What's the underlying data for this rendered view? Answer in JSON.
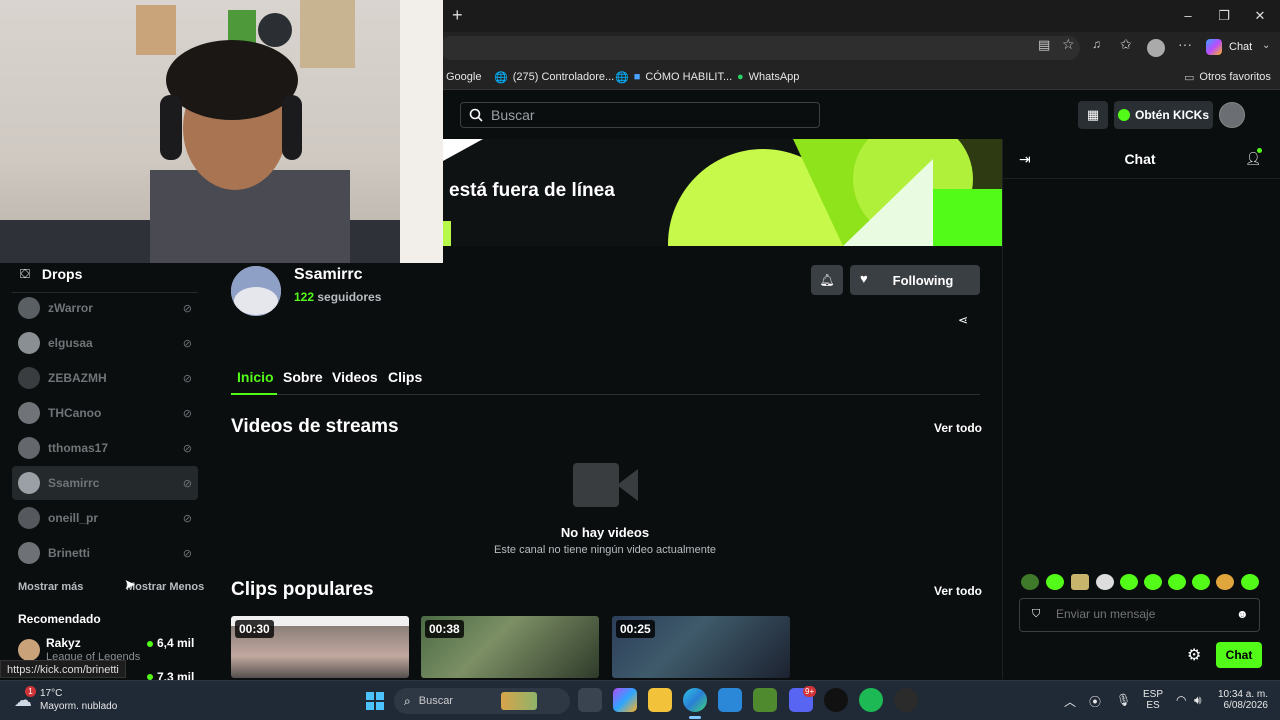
{
  "browser": {
    "chat_button": "Chat",
    "favorites": [
      {
        "label": "Google"
      },
      {
        "label": "(275) Controladore..."
      },
      {
        "label": "CÓMO HABILIT..."
      },
      {
        "label": "WhatsApp"
      }
    ],
    "other_favorites": "Otros favoritos",
    "status_url": "https://kick.com/brinetti"
  },
  "header": {
    "search_placeholder": "Buscar",
    "get_kicks": "Obtén KICKs"
  },
  "banner": {
    "offline_text": "está fuera de línea"
  },
  "sidebar": {
    "drops_label": "Drops",
    "following": [
      {
        "name": "zWarror"
      },
      {
        "name": "elgusaa"
      },
      {
        "name": "ZEBAZMH"
      },
      {
        "name": "THCanoo"
      },
      {
        "name": "tthomas17"
      },
      {
        "name": "Ssamirrc"
      },
      {
        "name": "oneill_pr"
      },
      {
        "name": "Brinetti"
      }
    ],
    "show_more": "Mostrar más",
    "show_less": "Mostrar Menos",
    "recommended_title": "Recomendado",
    "recommended": [
      {
        "name": "Rakyz",
        "category": "League of Legends",
        "viewers": "6,4 mil"
      },
      {
        "viewers": "7,3 mil"
      }
    ]
  },
  "channel": {
    "name": "Ssamirrc",
    "followers_count": "122",
    "followers_label": "seguidores",
    "following_button": "Following",
    "tabs": [
      "Inicio",
      "Sobre",
      "Videos",
      "Clips"
    ],
    "active_tab": "Inicio",
    "videos_title": "Videos de streams",
    "see_all": "Ver todo",
    "no_videos_title": "No hay videos",
    "no_videos_desc": "Este canal no tiene ningún video actualmente",
    "clips_title": "Clips populares",
    "clips": [
      {
        "duration": "00:30"
      },
      {
        "duration": "00:38"
      },
      {
        "duration": "00:25"
      }
    ]
  },
  "chat": {
    "title": "Chat",
    "input_placeholder": "Enviar un mensaje",
    "send_button": "Chat"
  },
  "taskbar": {
    "weather_temp": "17°C",
    "weather_desc": "Mayorm. nublado",
    "weather_badge": "1",
    "search_placeholder": "Buscar",
    "lang_top": "ESP",
    "lang_bottom": "ES",
    "time": "10:34 a. m.",
    "date": "6/08/2026",
    "discord_badge": "9+"
  },
  "colors": {
    "accent": "#53fc18",
    "background": "#0b0e0f",
    "button_gray": "#3a3f44"
  }
}
